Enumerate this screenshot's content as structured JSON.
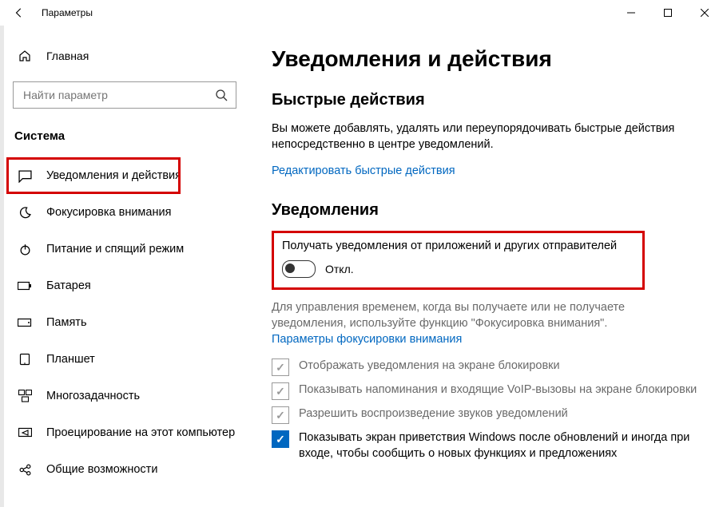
{
  "titlebar": {
    "title": "Параметры"
  },
  "sidebar": {
    "home": "Главная",
    "search_placeholder": "Найти параметр",
    "category": "Система",
    "items": [
      {
        "label": "Уведомления и действия"
      },
      {
        "label": "Фокусировка внимания"
      },
      {
        "label": "Питание и спящий режим"
      },
      {
        "label": "Батарея"
      },
      {
        "label": "Память"
      },
      {
        "label": "Планшет"
      },
      {
        "label": "Многозадачность"
      },
      {
        "label": "Проецирование на этот компьютер"
      },
      {
        "label": "Общие возможности"
      }
    ]
  },
  "main": {
    "h1": "Уведомления и действия",
    "quick": {
      "h2": "Быстрые действия",
      "desc": "Вы можете добавлять, удалять или переупорядочивать быстрые действия непосредственно в центре уведомлений.",
      "link": "Редактировать быстрые действия"
    },
    "notif": {
      "h2": "Уведомления",
      "toggle_label": "Получать уведомления от приложений и других отправителей",
      "toggle_state": "Откл.",
      "focus_desc": "Для управления временем, когда вы получаете или не получаете уведомления, используйте функцию \"Фокусировка внимания\".",
      "focus_link": "Параметры фокусировки внимания",
      "checks": [
        {
          "label": "Отображать уведомления на экране блокировки"
        },
        {
          "label": "Показывать напоминания и входящие VoIP-вызовы на экране блокировки"
        },
        {
          "label": "Разрешить  воспроизведение звуков уведомлений"
        },
        {
          "label": "Показывать экран приветствия Windows после обновлений и иногда при входе, чтобы сообщить о новых функциях и предложениях"
        }
      ]
    }
  }
}
